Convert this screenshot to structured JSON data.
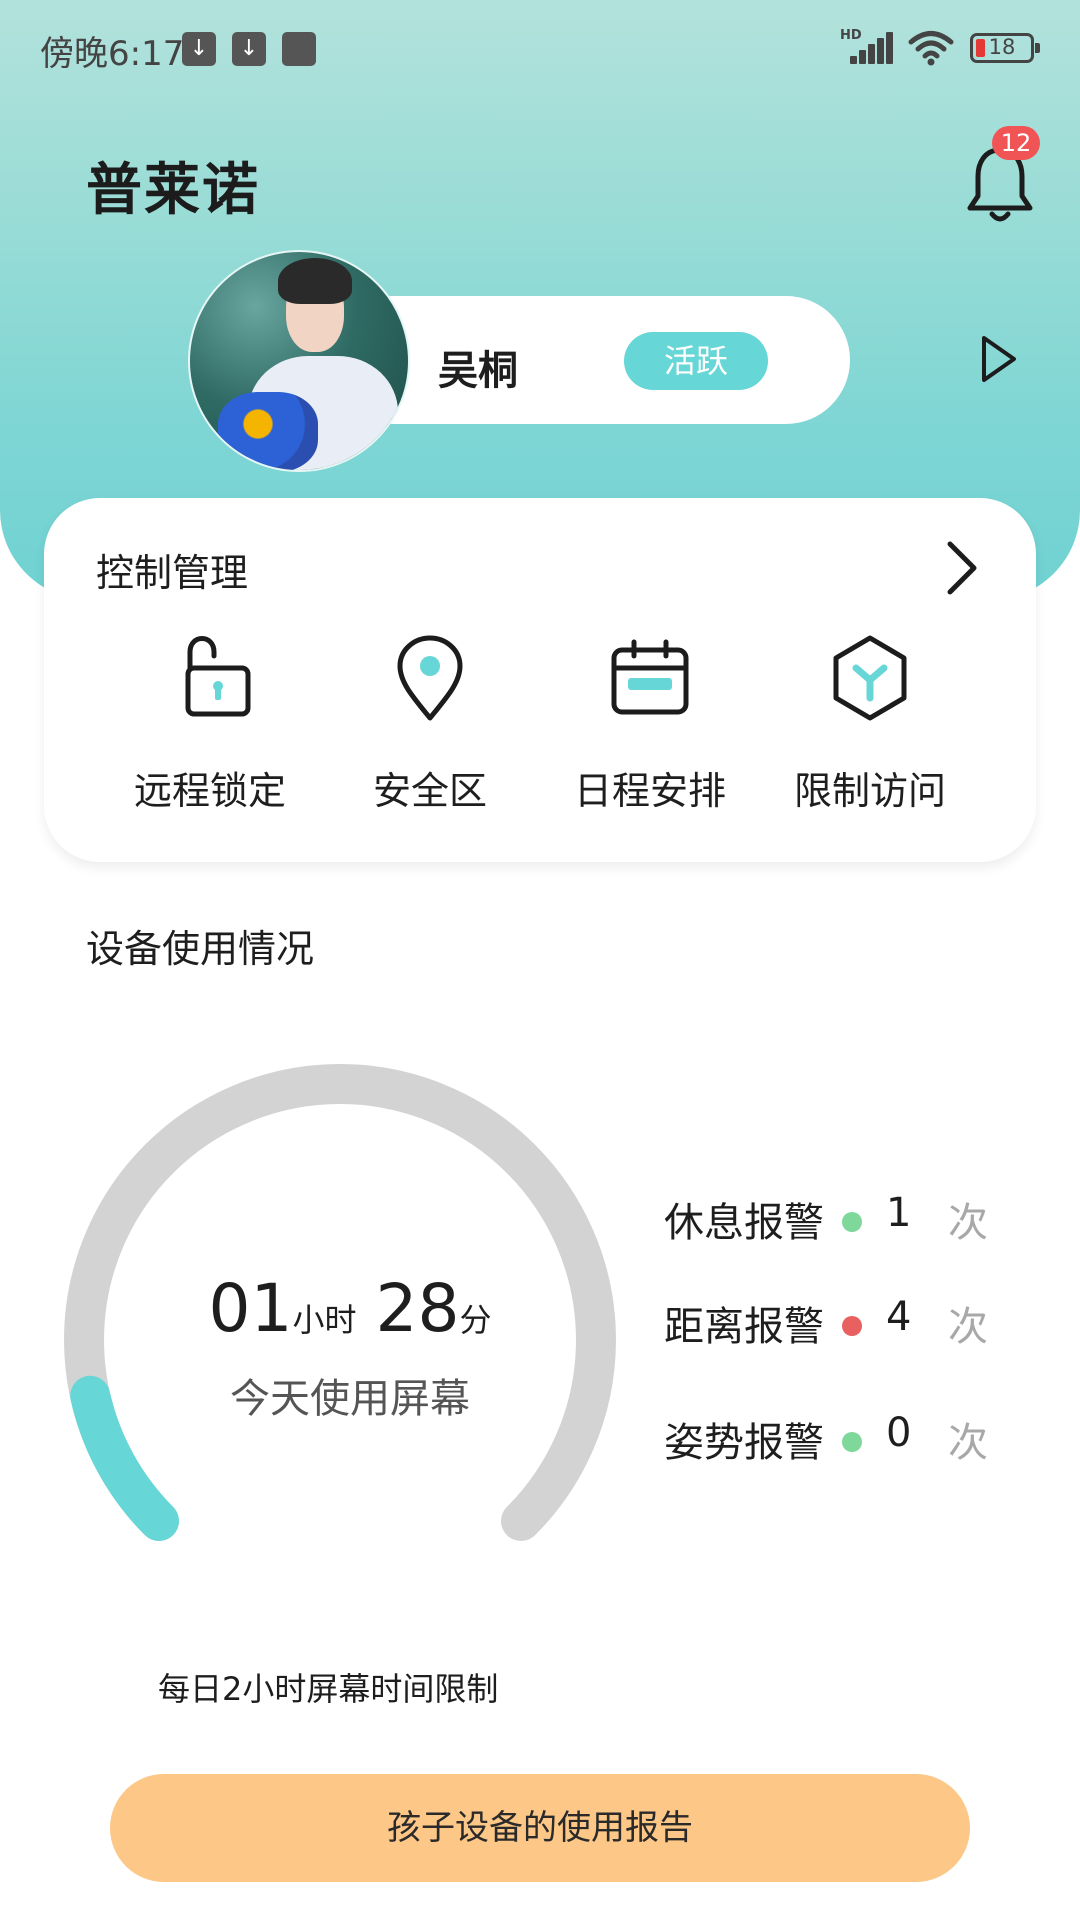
{
  "status_bar": {
    "time": "傍晚6:17",
    "signal_label": "HD",
    "battery_level": "18",
    "notification_icons": [
      "download-icon",
      "download-icon",
      "app-icon"
    ]
  },
  "header": {
    "title": "普莱诺",
    "notification_count": "12"
  },
  "profile": {
    "name": "吴桐",
    "status": "活跃"
  },
  "control": {
    "title": "控制管理",
    "items": [
      {
        "label": "远程锁定",
        "icon": "unlock-icon"
      },
      {
        "label": "安全区",
        "icon": "location-pin-icon"
      },
      {
        "label": "日程安排",
        "icon": "calendar-icon"
      },
      {
        "label": "限制访问",
        "icon": "restrict-hexagon-icon"
      }
    ]
  },
  "usage": {
    "title": "设备使用情况",
    "hours": "01",
    "hours_unit": "小时",
    "minutes": "28",
    "minutes_unit": "分",
    "today_label": "今天使用屏幕",
    "progress_fraction": 0.12,
    "alerts": [
      {
        "label": "休息报警",
        "count": "1",
        "unit": "次",
        "color": "#7dd89a"
      },
      {
        "label": "距离报警",
        "count": "4",
        "unit": "次",
        "color": "#e86060"
      },
      {
        "label": "姿势报警",
        "count": "0",
        "unit": "次",
        "color": "#7dd89a"
      }
    ],
    "limit_text": "每日2小时屏幕时间限制"
  },
  "report_button": {
    "label": "孩子设备的使用报告"
  },
  "colors": {
    "accent": "#66d6d6",
    "gauge_track": "#d3d3d3",
    "badge": "#f05454",
    "button": "#fcc787"
  }
}
